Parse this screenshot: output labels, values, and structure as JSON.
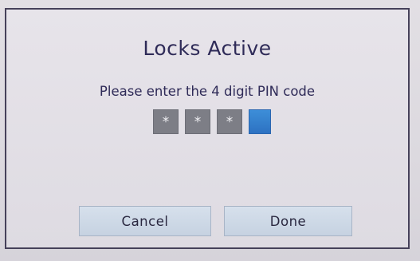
{
  "dialog": {
    "title": "Locks Active",
    "prompt": "Please enter the 4 digit PIN code",
    "pin": {
      "entered_mask": [
        "*",
        "*",
        "*"
      ],
      "active_box": ""
    },
    "buttons": {
      "cancel_label": "Cancel",
      "done_label": "Done"
    }
  },
  "colors": {
    "title_text": "#2f2b58",
    "dialog_border": "#46415a",
    "pin_filled": "#7d7e86",
    "pin_active": "#2d72c2",
    "button_bg": "#cfd9e7"
  }
}
